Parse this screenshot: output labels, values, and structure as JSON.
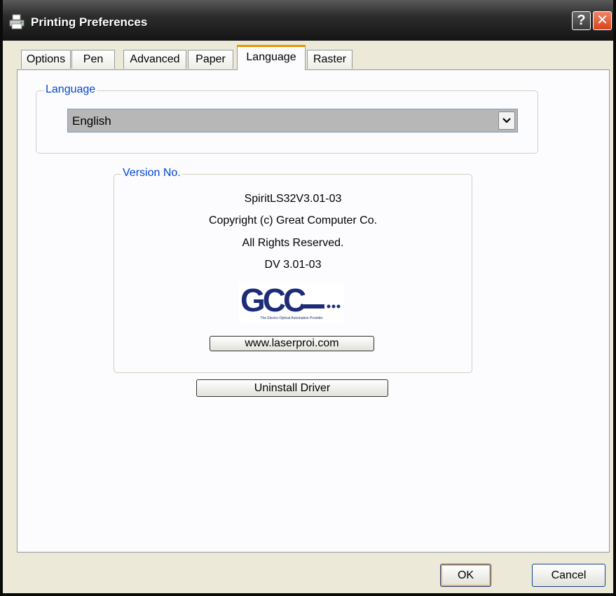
{
  "window": {
    "title": "Printing Preferences",
    "help_label": "?",
    "close_label": "✕"
  },
  "tabs": [
    {
      "label": "Options",
      "active": false
    },
    {
      "label": "Pen",
      "active": false
    },
    {
      "label": "Advanced",
      "active": false
    },
    {
      "label": "Paper",
      "active": false
    },
    {
      "label": "Language",
      "active": true
    },
    {
      "label": "Raster",
      "active": false
    }
  ],
  "language": {
    "group_label": "Language",
    "selected": "English"
  },
  "version": {
    "group_label": "Version No.",
    "lines": [
      "SpiritLS32V3.01-03",
      "Copyright (c) Great Computer Co.",
      "All Rights Reserved.",
      "DV 3.01-03"
    ],
    "logo_text": "GCC",
    "logo_tagline": "The Electro-Optical Automation Provider",
    "url_button": "www.laserproi.com"
  },
  "actions": {
    "uninstall": "Uninstall Driver",
    "ok": "OK",
    "cancel": "Cancel"
  },
  "colors": {
    "group_label": "#0046d5",
    "logo_blue": "#1e2c78",
    "active_tab_accent": "#e59700"
  },
  "icons": {
    "title": "printer-icon",
    "select_arrow": "chevron-down-icon"
  }
}
